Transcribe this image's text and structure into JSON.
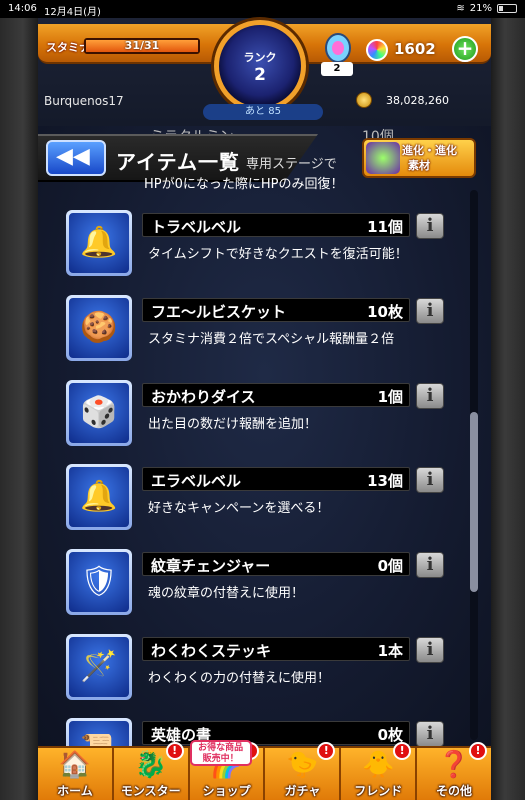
{
  "status_bar": {
    "time": "14:06",
    "date": "12月4日(月)",
    "battery": "21%"
  },
  "hud": {
    "stamina_label": "スタミナ",
    "stamina": "31/31",
    "stamina_fill": 1.0,
    "rank_label": "ランク",
    "rank": "2",
    "egg_count": "2",
    "orb_count": "1602",
    "plus_label": "+",
    "username": "Burquenos17",
    "exp_remaining": "あと 85",
    "coins": "38,028,260"
  },
  "header": {
    "back_label": "◀◀",
    "title": "アイテム一覧",
    "evo_label_line1": "進化・進化",
    "evo_label_line2": "素材"
  },
  "ghost_item": {
    "name": "ミラクルミン",
    "count": "10個",
    "desc1": "専用ステージで",
    "desc2": "HPが0になった際にHPのみ回復！"
  },
  "items": [
    {
      "name": "トラベルベル",
      "count": "11個",
      "desc": "タイムシフトで好きなクエストを復活可能！",
      "icon": "🔔"
    },
    {
      "name": "フエ〜ルビスケット",
      "count": "10枚",
      "desc": "スタミナ消費２倍でスペシャル報酬量２倍",
      "icon": "🍪"
    },
    {
      "name": "おかわりダイス",
      "count": "1個",
      "desc": "出た目の数だけ報酬を追加！",
      "icon": "🎲"
    },
    {
      "name": "エラベルベル",
      "count": "13個",
      "desc": "好きなキャンペーンを選べる！",
      "icon": "🔔"
    },
    {
      "name": "紋章チェンジャー",
      "count": "0個",
      "desc": "魂の紋章の付替えに使用！",
      "icon": "🛡"
    },
    {
      "name": "わくわくステッキ",
      "count": "1本",
      "desc": "わくわくの力の付替えに使用！",
      "icon": "🪄"
    },
    {
      "name": "英雄の書",
      "count": "0枚",
      "desc": "",
      "icon": "📜"
    }
  ],
  "info_label": "i",
  "nav": [
    {
      "label": "ホーム",
      "icon": "🏠",
      "badge": ""
    },
    {
      "label": "モンスター",
      "icon": "🐉",
      "badge": "!"
    },
    {
      "label": "ショップ",
      "icon": "🌈",
      "badge": "!",
      "sale_line1": "お得な商品",
      "sale_line2": "販売中！"
    },
    {
      "label": "ガチャ",
      "icon": "🐤",
      "badge": "!"
    },
    {
      "label": "フレンド",
      "icon": "🐥",
      "badge": "!"
    },
    {
      "label": "その他",
      "icon": "❓",
      "badge": "!"
    }
  ]
}
